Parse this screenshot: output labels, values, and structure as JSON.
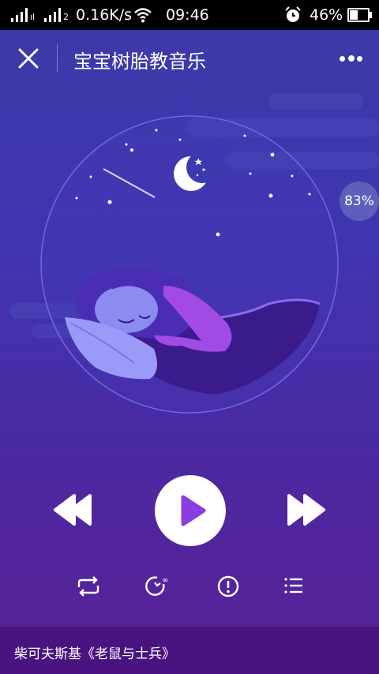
{
  "status_bar": {
    "network_speed": "0.16K/s",
    "time": "09:46",
    "battery_percent": "46%",
    "battery_level": 0.46,
    "icons": [
      "signal-icon",
      "signal-icon",
      "wifi-icon",
      "alarm-icon",
      "battery-icon"
    ]
  },
  "header": {
    "title": "宝宝树胎教音乐",
    "close_icon": "close-icon",
    "more_icon": "more-dots-icon"
  },
  "badge": {
    "text": "83%"
  },
  "controls": {
    "rewind_icon": "rewind-icon",
    "play_icon": "play-icon",
    "fast_forward_icon": "fast-forward-icon",
    "repeat_icon": "repeat-icon",
    "timer_icon": "timer-icon",
    "info_icon": "info-icon",
    "playlist_icon": "playlist-icon"
  },
  "footer": {
    "track": "柴可夫斯基《老鼠与士兵》"
  },
  "colors": {
    "accent": "#8a3de0",
    "bg_top": "#3b3aa6",
    "bg_bottom": "#5a2096"
  }
}
